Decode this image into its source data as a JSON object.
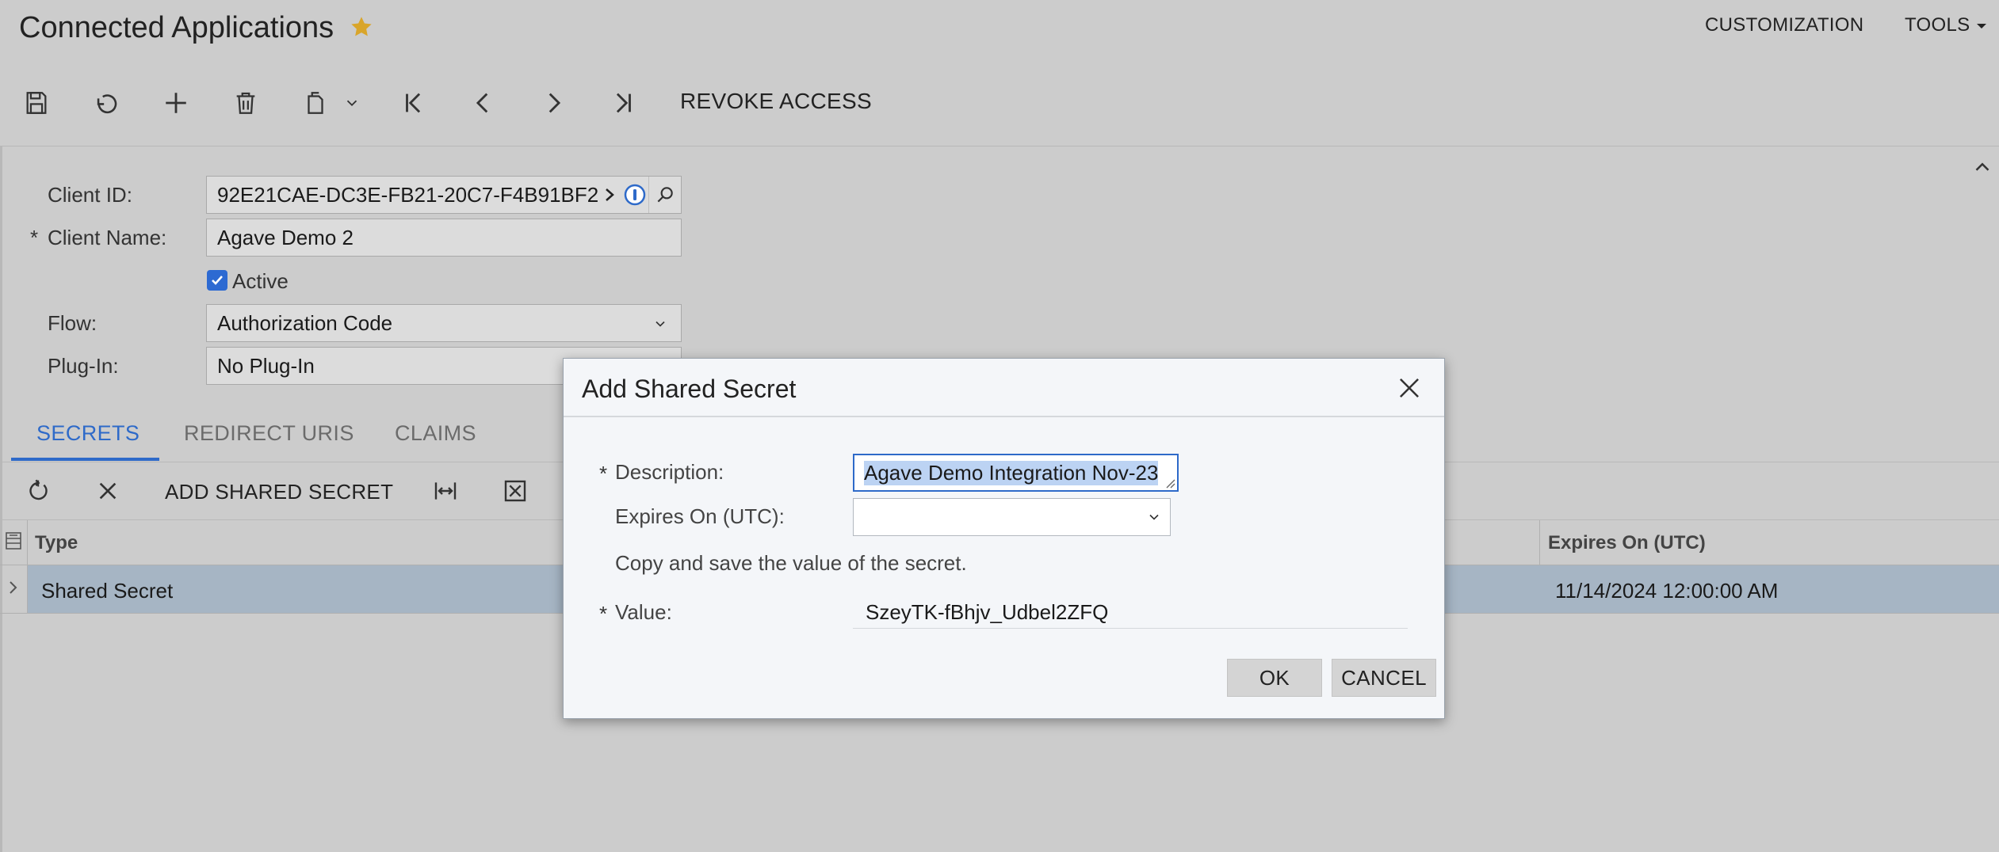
{
  "header": {
    "title": "Connected Applications",
    "menu": {
      "customization": "CUSTOMIZATION",
      "tools": "TOOLS"
    }
  },
  "toolbar": {
    "icons": [
      "save-icon",
      "undo-icon",
      "add-icon",
      "delete-icon",
      "copy-paste-icon",
      "first-record-icon",
      "previous-record-icon",
      "next-record-icon",
      "last-record-icon"
    ],
    "revoke_access": "REVOKE ACCESS"
  },
  "form": {
    "client_id_label": "Client ID:",
    "client_id_value": "92E21CAE-DC3E-FB21-20C7-F4B91BF2",
    "client_name_label": "Client Name:",
    "client_name_value": "Agave Demo 2",
    "active_label": "Active",
    "active_checked": true,
    "flow_label": "Flow:",
    "flow_value": "Authorization Code",
    "plugin_label": "Plug-In:",
    "plugin_value": "No Plug-In",
    "required_mark": "*"
  },
  "tabs": [
    {
      "label": "SECRETS",
      "active": true
    },
    {
      "label": "REDIRECT URIS",
      "active": false
    },
    {
      "label": "CLAIMS",
      "active": false
    }
  ],
  "grid_toolbar": {
    "add_shared_secret": "ADD SHARED SECRET"
  },
  "grid": {
    "columns": {
      "type": "Type",
      "expires_on": "Expires On (UTC)"
    },
    "rows": [
      {
        "type": "Shared Secret",
        "expires_on": "11/14/2024 12:00:00 AM"
      }
    ]
  },
  "dialog": {
    "title": "Add Shared Secret",
    "description_label": "Description:",
    "description_value": "Agave Demo Integration Nov-23",
    "expires_label": "Expires On (UTC):",
    "expires_value": "",
    "copy_note": "Copy and save the value of the secret.",
    "value_label": "Value:",
    "value": "SzeyTK-fBhjv_Udbel2ZFQ",
    "ok": "OK",
    "cancel": "CANCEL",
    "required_mark": "*"
  },
  "colors": {
    "accent": "#2e6ac9",
    "star": "#d9a52a",
    "selected_row": "#a6b5c4",
    "background": "#cccccc"
  }
}
